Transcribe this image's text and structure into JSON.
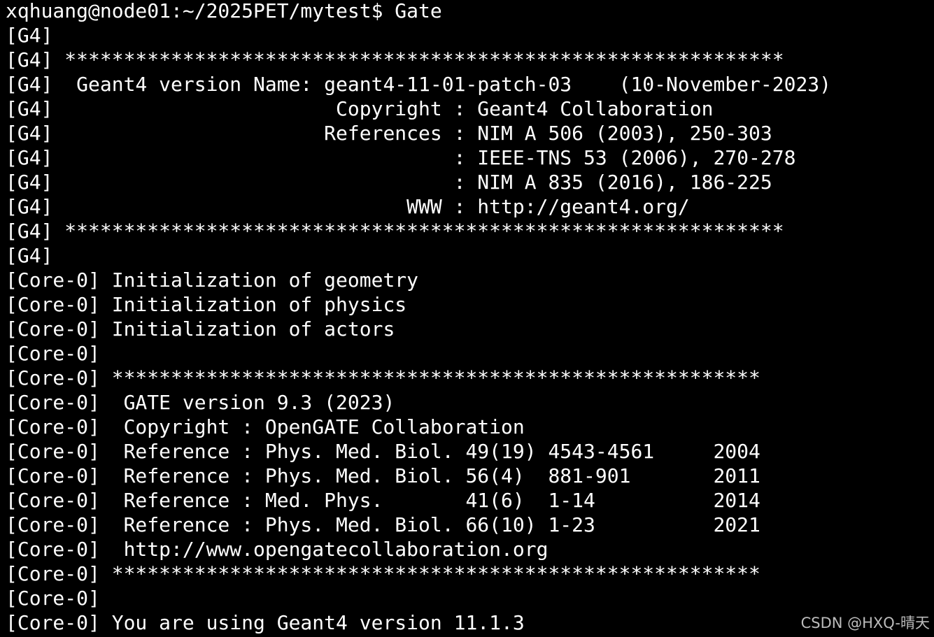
{
  "terminal": {
    "lines": [
      "xqhuang@node01:~/2025PET/mytest$ Gate",
      "[G4]",
      "[G4] *************************************************************",
      "[G4]  Geant4 version Name: geant4-11-01-patch-03    (10-November-2023)",
      "[G4]                        Copyright : Geant4 Collaboration",
      "[G4]                       References : NIM A 506 (2003), 250-303",
      "[G4]                                  : IEEE-TNS 53 (2006), 270-278",
      "[G4]                                  : NIM A 835 (2016), 186-225",
      "[G4]                              WWW : http://geant4.org/",
      "[G4] *************************************************************",
      "[G4]",
      "[Core-0] Initialization of geometry",
      "[Core-0] Initialization of physics",
      "[Core-0] Initialization of actors",
      "[Core-0]",
      "[Core-0] *******************************************************",
      "[Core-0]  GATE version 9.3 (2023)",
      "[Core-0]  Copyright : OpenGATE Collaboration",
      "[Core-0]  Reference : Phys. Med. Biol. 49(19) 4543-4561     2004",
      "[Core-0]  Reference : Phys. Med. Biol. 56(4)  881-901       2011",
      "[Core-0]  Reference : Med. Phys.       41(6)  1-14          2014",
      "[Core-0]  Reference : Phys. Med. Biol. 66(10) 1-23          2021",
      "[Core-0]  http://www.opengatecollaboration.org",
      "[Core-0] *******************************************************",
      "[Core-0]",
      "[Core-0] You are using Geant4 version 11.1.3"
    ]
  },
  "watermark": "CSDN @HXQ-晴天",
  "colors": {
    "background": "#000000",
    "foreground": "#ffffff",
    "watermark": "#d0d0d0"
  }
}
